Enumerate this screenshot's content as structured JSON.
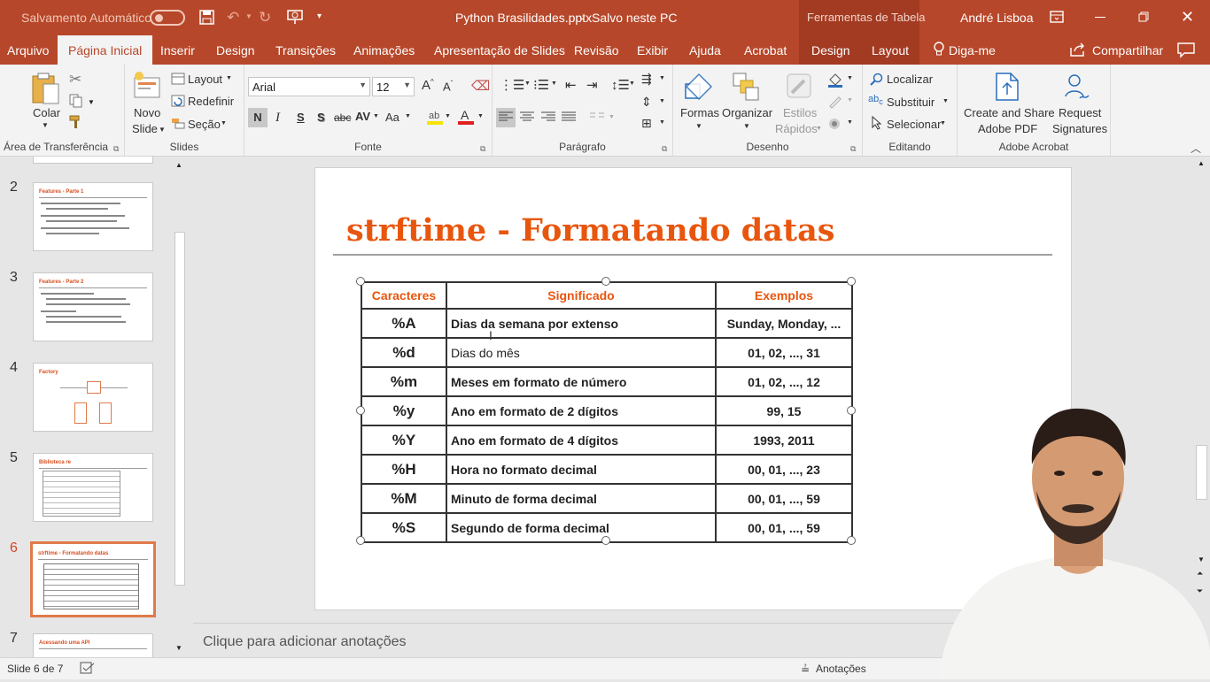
{
  "titlebar": {
    "autosave_label": "Salvamento Automático",
    "document_title": "Python Brasilidades.pptx",
    "separator": "-",
    "save_status": "Salvo neste PC",
    "tools_context": "Ferramentas de Tabela",
    "user_name": "André Lisboa"
  },
  "tabs": [
    "Arquivo",
    "Página Inicial",
    "Inserir",
    "Design",
    "Transições",
    "Animações",
    "Apresentação de Slides",
    "Revisão",
    "Exibir",
    "Ajuda",
    "Acrobat",
    "Design",
    "Layout"
  ],
  "tellme": "Diga-me",
  "share": "Compartilhar",
  "ribbon": {
    "clipboard": {
      "paste": "Colar",
      "label": "Área de Transferência"
    },
    "slides": {
      "new_slide_1": "Novo",
      "new_slide_2": "Slide",
      "layout": "Layout",
      "reset": "Redefinir",
      "section": "Seção",
      "label": "Slides"
    },
    "font": {
      "name": "Arial",
      "size": "12",
      "bold": "N",
      "italic": "I",
      "underline": "S",
      "shadow": "S",
      "strike": "abc",
      "spacing": "AV",
      "case": "Aa",
      "label": "Fonte"
    },
    "paragraph": {
      "label": "Parágrafo"
    },
    "drawing": {
      "shapes": "Formas",
      "arrange": "Organizar",
      "styles_1": "Estilos",
      "styles_2": "Rápidos",
      "label": "Desenho"
    },
    "editing": {
      "find": "Localizar",
      "replace": "Substituir",
      "select": "Selecionar",
      "label": "Editando"
    },
    "acrobat": {
      "create_1": "Create and Share",
      "create_2": "Adobe PDF",
      "request_1": "Request",
      "request_2": "Signatures",
      "label": "Adobe Acrobat"
    }
  },
  "thumbnails": [
    {
      "num": "2",
      "title": "Features - Parte 1"
    },
    {
      "num": "3",
      "title": "Features - Parte 2"
    },
    {
      "num": "4",
      "title": "Factory"
    },
    {
      "num": "5",
      "title": "Biblioteca re"
    },
    {
      "num": "6",
      "title": "strftime - Formatando datas"
    },
    {
      "num": "7",
      "title": "Acessando uma API"
    }
  ],
  "slide": {
    "title": "strftime - Formatando datas",
    "headers": [
      "Caracteres",
      "Significado",
      "Exemplos"
    ],
    "rows": [
      [
        "%A",
        "Dias da semana por extenso",
        "Sunday, Monday, ..."
      ],
      [
        "%d",
        "Dias do mês",
        "01, 02, ..., 31"
      ],
      [
        "%m",
        "Meses em formato de número",
        "01, 02, ..., 12"
      ],
      [
        "%y",
        "Ano em formato de 2 dígitos",
        "99, 15"
      ],
      [
        "%Y",
        "Ano em formato de 4 dígitos",
        "1993, 2011"
      ],
      [
        "%H",
        "Hora no formato decimal",
        "00, 01, ..., 23"
      ],
      [
        "%M",
        "Minuto de forma decimal",
        "00, 01, ..., 59"
      ],
      [
        "%S",
        "Segundo de forma decimal",
        "00, 01, ..., 59"
      ]
    ]
  },
  "notes_placeholder": "Clique para adicionar anotações",
  "status": {
    "slide_info": "Slide 6 de 7",
    "notes": "Anotações"
  },
  "colors": {
    "accent": "#b7472a",
    "title_orange": "#e8560e"
  }
}
